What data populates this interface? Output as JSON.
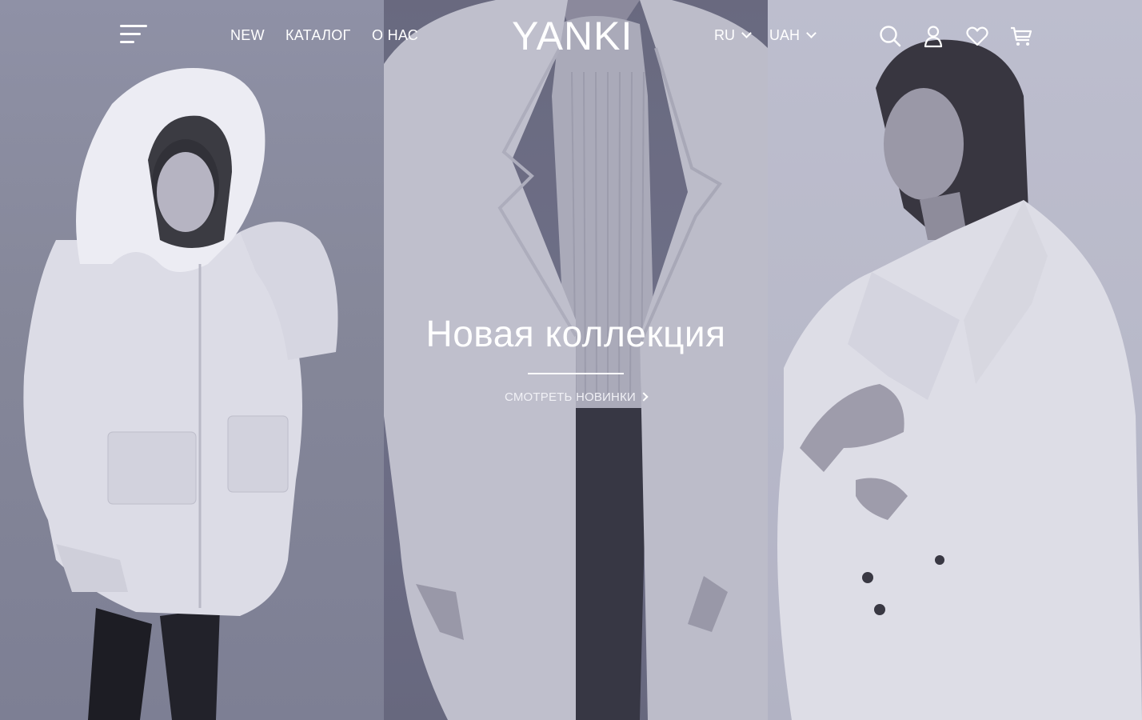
{
  "header": {
    "logo": "YANKI",
    "nav": [
      {
        "label": "NEW"
      },
      {
        "label": "КАТАЛОГ"
      },
      {
        "label": "О НАС"
      }
    ],
    "language": {
      "selected": "RU"
    },
    "currency": {
      "selected": "UAH"
    },
    "icons": [
      "menu-icon",
      "search-icon",
      "user-icon",
      "heart-icon",
      "cart-icon"
    ]
  },
  "hero": {
    "title": "Новая коллекция",
    "cta_label": "СМОТРЕТЬ НОВИНКИ"
  },
  "colors": {
    "text": "#ffffff",
    "overlay_tint": "#6e6f85"
  }
}
